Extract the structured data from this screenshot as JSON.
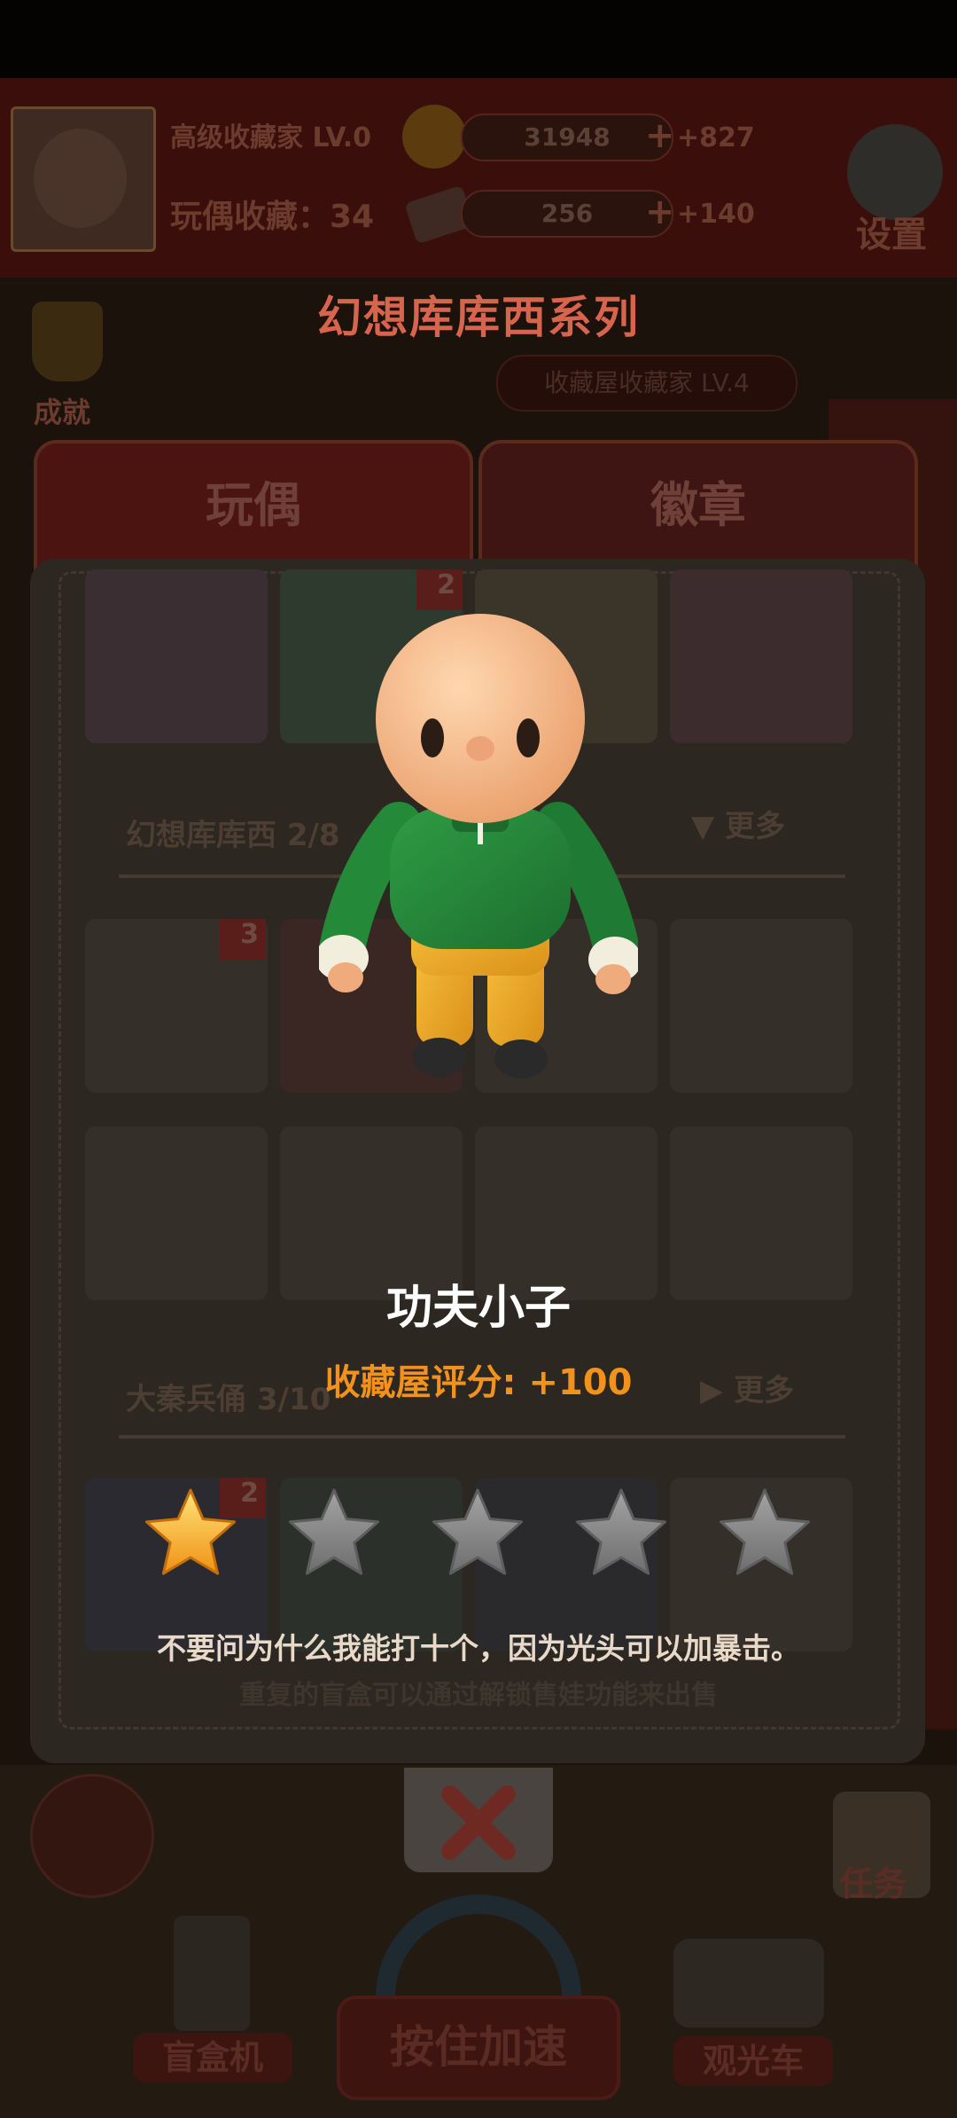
{
  "background": {
    "player_title": "高级收藏家 LV.0",
    "coins": "31948",
    "coin_income": "+827",
    "collection_label": "玩偶收藏：34",
    "tickets": "256",
    "ticket_income": "+140",
    "settings_label": "设置",
    "achievements_label": "成就",
    "collection_house_level": "收藏屋收藏家 LV.4",
    "tabs": [
      "玩偶",
      "徽章"
    ],
    "series_1": {
      "name": "幻想库库西 2/8",
      "more": "更多"
    },
    "series_2": {
      "name": "大秦兵俑 3/10",
      "more": "更多"
    },
    "card_badges": [
      "2",
      "3",
      "2"
    ],
    "hint": "重复的盲盒可以通过解锁售娃功能来出售",
    "task_label": "任务",
    "blindbox_label": "盲盒机",
    "boost_label": "按住加速",
    "tour_label": "观光车"
  },
  "popup": {
    "series_title": "幻想库库西系列",
    "figure_name": "功夫小子",
    "score_text": "收藏屋评分: +100",
    "stars_total": 5,
    "stars_filled": 1,
    "description": "不要问为什么我能打十个，因为光头可以加暴击。",
    "close_icon": "close-x-icon"
  },
  "colors": {
    "title": "#d9644e",
    "score": "#f0921c",
    "star_filled": "#f5a417",
    "star_empty": "#8a8a8a"
  }
}
